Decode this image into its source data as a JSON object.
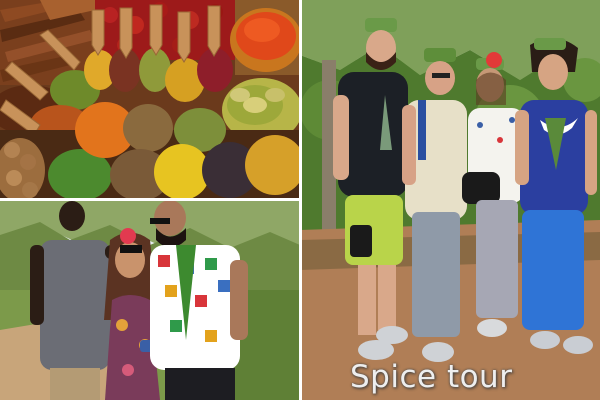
{
  "caption": "Spice tour"
}
